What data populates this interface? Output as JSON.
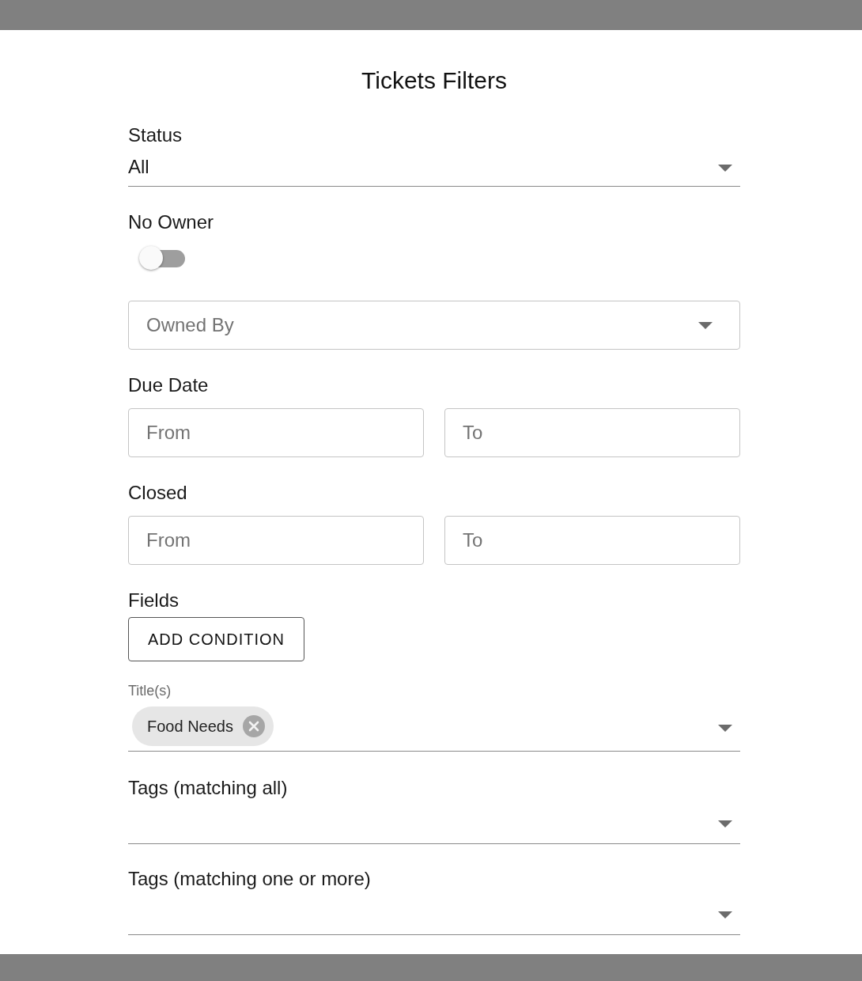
{
  "title": "Tickets Filters",
  "status": {
    "label": "Status",
    "value": "All"
  },
  "no_owner": {
    "label": "No Owner",
    "on": false
  },
  "owned_by": {
    "placeholder": "Owned By"
  },
  "date_ranges": [
    {
      "label": "Due Date",
      "from": {
        "placeholder": "From"
      },
      "to": {
        "placeholder": "To"
      }
    },
    {
      "label": "Closed",
      "from": {
        "placeholder": "From"
      },
      "to": {
        "placeholder": "To"
      }
    }
  ],
  "fields": {
    "label": "Fields",
    "button": "ADD CONDITION"
  },
  "titles": {
    "label": "Title(s)",
    "chips": [
      "Food Needs"
    ]
  },
  "tag_selects": [
    {
      "label": "Tags (matching all)"
    },
    {
      "label": "Tags (matching one or more)"
    }
  ]
}
